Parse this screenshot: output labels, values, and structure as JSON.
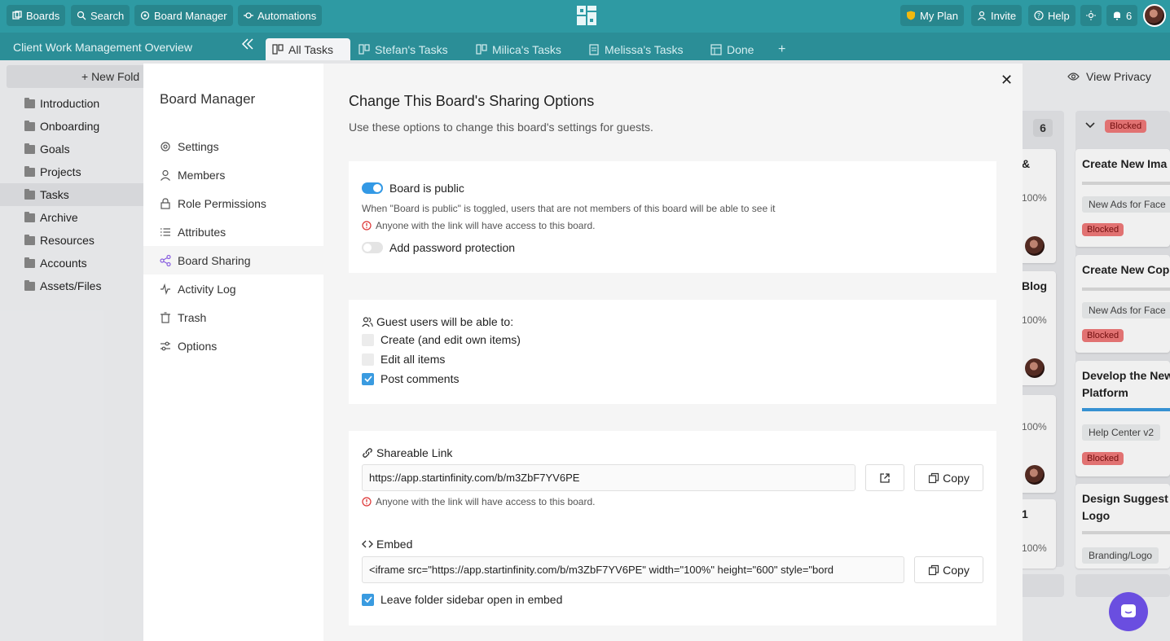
{
  "topbar": {
    "boards": "Boards",
    "search": "Search",
    "board_manager": "Board Manager",
    "automations": "Automations",
    "my_plan": "My Plan",
    "invite": "Invite",
    "help": "Help",
    "notif_count": "6"
  },
  "subbar": {
    "board_title": "Client Work Management Overview",
    "tabs": [
      {
        "label": "All Tasks"
      },
      {
        "label": "Stefan's Tasks"
      },
      {
        "label": "Milica's Tasks"
      },
      {
        "label": "Melissa's Tasks"
      },
      {
        "label": "Done"
      }
    ],
    "add_tab": "+"
  },
  "sidebar": {
    "new_folder": "+ New Fold",
    "folders": [
      "Introduction",
      "Onboarding",
      "Goals",
      "Projects",
      "Tasks",
      "Archive",
      "Resources",
      "Accounts",
      "Assets/Files"
    ]
  },
  "kanban": {
    "view_privacy": "View Privacy",
    "count": "6",
    "col_status": "Blocked",
    "partial_texts": [
      "&",
      "100%",
      "Blog",
      "100%",
      "100%",
      "1",
      "100%"
    ],
    "cards": [
      {
        "title": "Create New Ima",
        "chip": "New Ads for Face",
        "status": "Blocked"
      },
      {
        "title": "Create New Cop",
        "chip": "New Ads for Face",
        "status": "Blocked"
      },
      {
        "title": "Develop the New",
        "title2": "Platform",
        "chip": "Help Center v2",
        "status": "Blocked"
      },
      {
        "title": "Design Suggest",
        "title2": "Logo",
        "chip": "Branding/Logo"
      }
    ]
  },
  "modal": {
    "nav_title": "Board Manager",
    "nav": [
      {
        "label": "Settings",
        "icon": "gear-icon"
      },
      {
        "label": "Members",
        "icon": "user-icon"
      },
      {
        "label": "Role Permissions",
        "icon": "lock-icon"
      },
      {
        "label": "Attributes",
        "icon": "list-icon"
      },
      {
        "label": "Board Sharing",
        "icon": "share-icon"
      },
      {
        "label": "Activity Log",
        "icon": "activity-icon"
      },
      {
        "label": "Trash",
        "icon": "trash-icon"
      },
      {
        "label": "Options",
        "icon": "sliders-icon"
      }
    ],
    "close": "✕",
    "heading": "Change This Board's Sharing Options",
    "subheading": "Use these options to change this board's settings for guests.",
    "public": {
      "toggle_label": "Board is public",
      "description": "When \"Board is public\" is toggled, users that are not members of this board will be able to see it",
      "warning": "Anyone with the link will have access to this board.",
      "password_label": "Add password protection"
    },
    "guests": {
      "heading": "Guest users will be able to:",
      "options": [
        {
          "label": "Create (and edit own items)",
          "checked": false
        },
        {
          "label": "Edit all items",
          "checked": false
        },
        {
          "label": "Post comments",
          "checked": true
        }
      ]
    },
    "link": {
      "heading": "Shareable Link",
      "url": "https://app.startinfinity.com/b/m3ZbF7YV6PE",
      "copy": "Copy",
      "warning": "Anyone with the link will have access to this board.",
      "embed_heading": "Embed",
      "embed_code": "<iframe src=\"https://app.startinfinity.com/b/m3ZbF7YV6PE\" width=\"100%\" height=\"600\" style=\"bord",
      "embed_copy": "Copy",
      "sidebar_option": "Leave folder sidebar open in embed"
    }
  },
  "colors": {
    "topbar": "#2e9aa3",
    "accent": "#3a9be0",
    "blocked": "#f07a7a",
    "chat": "#6a4ee0"
  }
}
